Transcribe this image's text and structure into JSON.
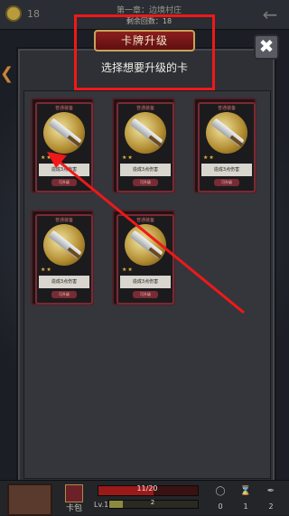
{
  "header": {
    "coins": "18",
    "stage_title": "第一章：边境村庄",
    "turns_label": "剩余回数：18"
  },
  "dialog": {
    "title": "卡牌升级",
    "subtitle": "选择想要升级的卡",
    "close_symbol": "✖"
  },
  "cards": [
    {
      "rarity": "普通装备",
      "stars": "★★",
      "desc": "造成3点伤害",
      "tag": "可升级"
    },
    {
      "rarity": "普通装备",
      "stars": "★★",
      "desc": "造成3点伤害",
      "tag": "可升级"
    },
    {
      "rarity": "普通装备",
      "stars": "★★",
      "desc": "造成3点伤害",
      "tag": "可升级"
    },
    {
      "rarity": "普通装备",
      "stars": "★★",
      "desc": "造成3点伤害",
      "tag": "可升级"
    },
    {
      "rarity": "普通装备",
      "stars": "★★",
      "desc": "造成3点伤害",
      "tag": "可升级"
    }
  ],
  "footer": {
    "deck_label": "卡包",
    "hp_text": "11/20",
    "hp_fraction": 0.55,
    "level": "Lv.1",
    "xp_text": "2",
    "xp_fraction": 0.15,
    "stats": [
      {
        "icon": "shield-icon",
        "value": "0"
      },
      {
        "icon": "hourglass-icon",
        "value": "1"
      },
      {
        "icon": "feather-icon",
        "value": "2"
      }
    ]
  },
  "colors": {
    "annotation": "#f01818",
    "ribbon": "#8c1e1e"
  }
}
